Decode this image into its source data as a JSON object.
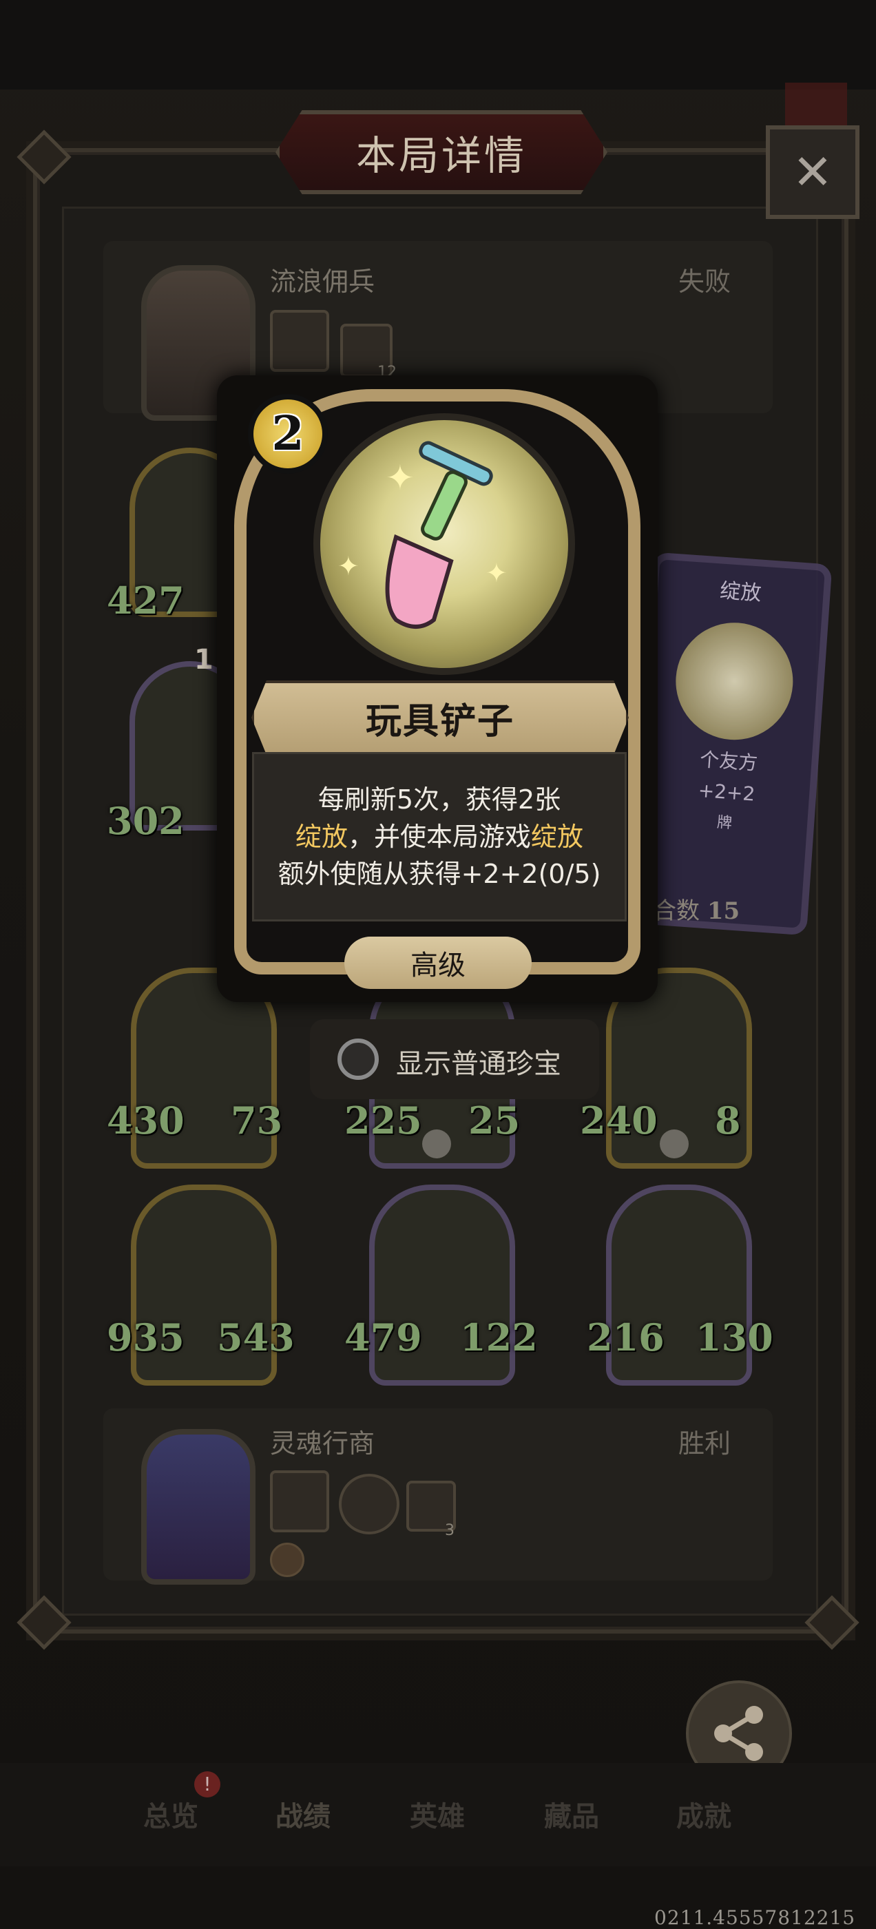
{
  "header": {
    "title": "本局详情"
  },
  "opponent": {
    "name": "流浪佣兵",
    "result": "失败",
    "item_count": "12"
  },
  "player": {
    "name": "灵魂行商",
    "result": "胜利",
    "item_count": "3"
  },
  "hero_stats": [
    {
      "atk": "427"
    },
    {
      "atk": "302",
      "level": "1"
    }
  ],
  "minions_row1": [
    {
      "atk": "430",
      "hp": "73"
    },
    {
      "atk": "225",
      "hp": "25"
    },
    {
      "atk": "240",
      "hp": "8"
    }
  ],
  "minions_row2": [
    {
      "atk": "935",
      "hp": "543"
    },
    {
      "atk": "479",
      "hp": "122"
    },
    {
      "atk": "216",
      "hp": "130"
    }
  ],
  "side_card": {
    "title": "绽放",
    "line1": "个友方",
    "line2": "+2+2",
    "line3": "牌",
    "deck_label": "合数",
    "deck_count": "15"
  },
  "treasure_card": {
    "cost": "2",
    "name": "玩具铲子",
    "desc_line1": "每刷新5次，获得2张",
    "desc_line2_a": "绽放",
    "desc_line2_b": "，并使本局游戏",
    "desc_line2_c": "绽放",
    "desc_line3": "额外使随从获得+2+2(0/5)",
    "tier": "高级"
  },
  "toggle": {
    "label": "显示普通珍宝",
    "checked": false
  },
  "share": {
    "label": "分享"
  },
  "tabs": [
    "总览",
    "战绩",
    "英雄",
    "藏品",
    "成就"
  ],
  "notification": "!",
  "version": "0211.45557812215",
  "colors": {
    "gold": "#f3c860",
    "stat_green": "#7e9c6a",
    "banner": "#c7b288"
  }
}
